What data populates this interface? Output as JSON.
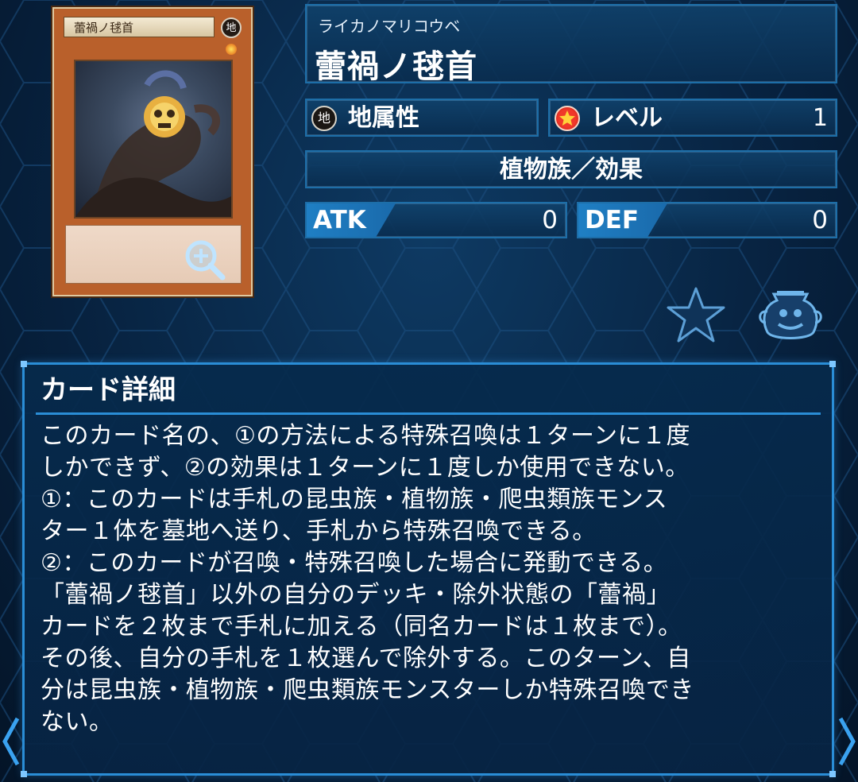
{
  "card": {
    "image_name_text": "蕾禍ノ毬首",
    "image_attribute_glyph": "地"
  },
  "header": {
    "ruby": "ライカノマリコウベ",
    "title": "蕾禍ノ毬首"
  },
  "attribute": {
    "icon_glyph": "地",
    "label": "地属性"
  },
  "level": {
    "label": "レベル",
    "value": "1"
  },
  "type_line": "植物族／効果",
  "stats": {
    "atk_label": "ATK",
    "atk_value": "0",
    "def_label": "DEF",
    "def_value": "0"
  },
  "actions": {
    "favorite_icon": "star-icon",
    "deck_icon": "pot-of-greed-icon",
    "zoom_icon": "zoom-in-icon"
  },
  "detail": {
    "title": "カード詳細",
    "lines": [
      "このカード名の、①の方法による特殊召喚は１ターンに１度",
      "しかできず、②の効果は１ターンに１度しか使用できない。",
      "①：このカードは手札の昆虫族・植物族・爬虫類族モンス",
      "ター１体を墓地へ送り、手札から特殊召喚できる。",
      "②：このカードが召喚・特殊召喚した場合に発動できる。",
      "「蕾禍ノ毬首」以外の自分のデッキ・除外状態の「蕾禍」",
      "カードを２枚まで手札に加える（同名カードは１枚まで）。",
      "その後、自分の手札を１枚選んで除外する。このターン、自",
      "分は昆虫族・植物族・爬虫類族モンスターしか特殊召喚でき",
      "ない。"
    ]
  },
  "colors": {
    "panel_border": "#1d6ea8",
    "accent_blue": "#2a8dd6",
    "card_frame": "#b9602b",
    "level_red": "#f0382a"
  }
}
